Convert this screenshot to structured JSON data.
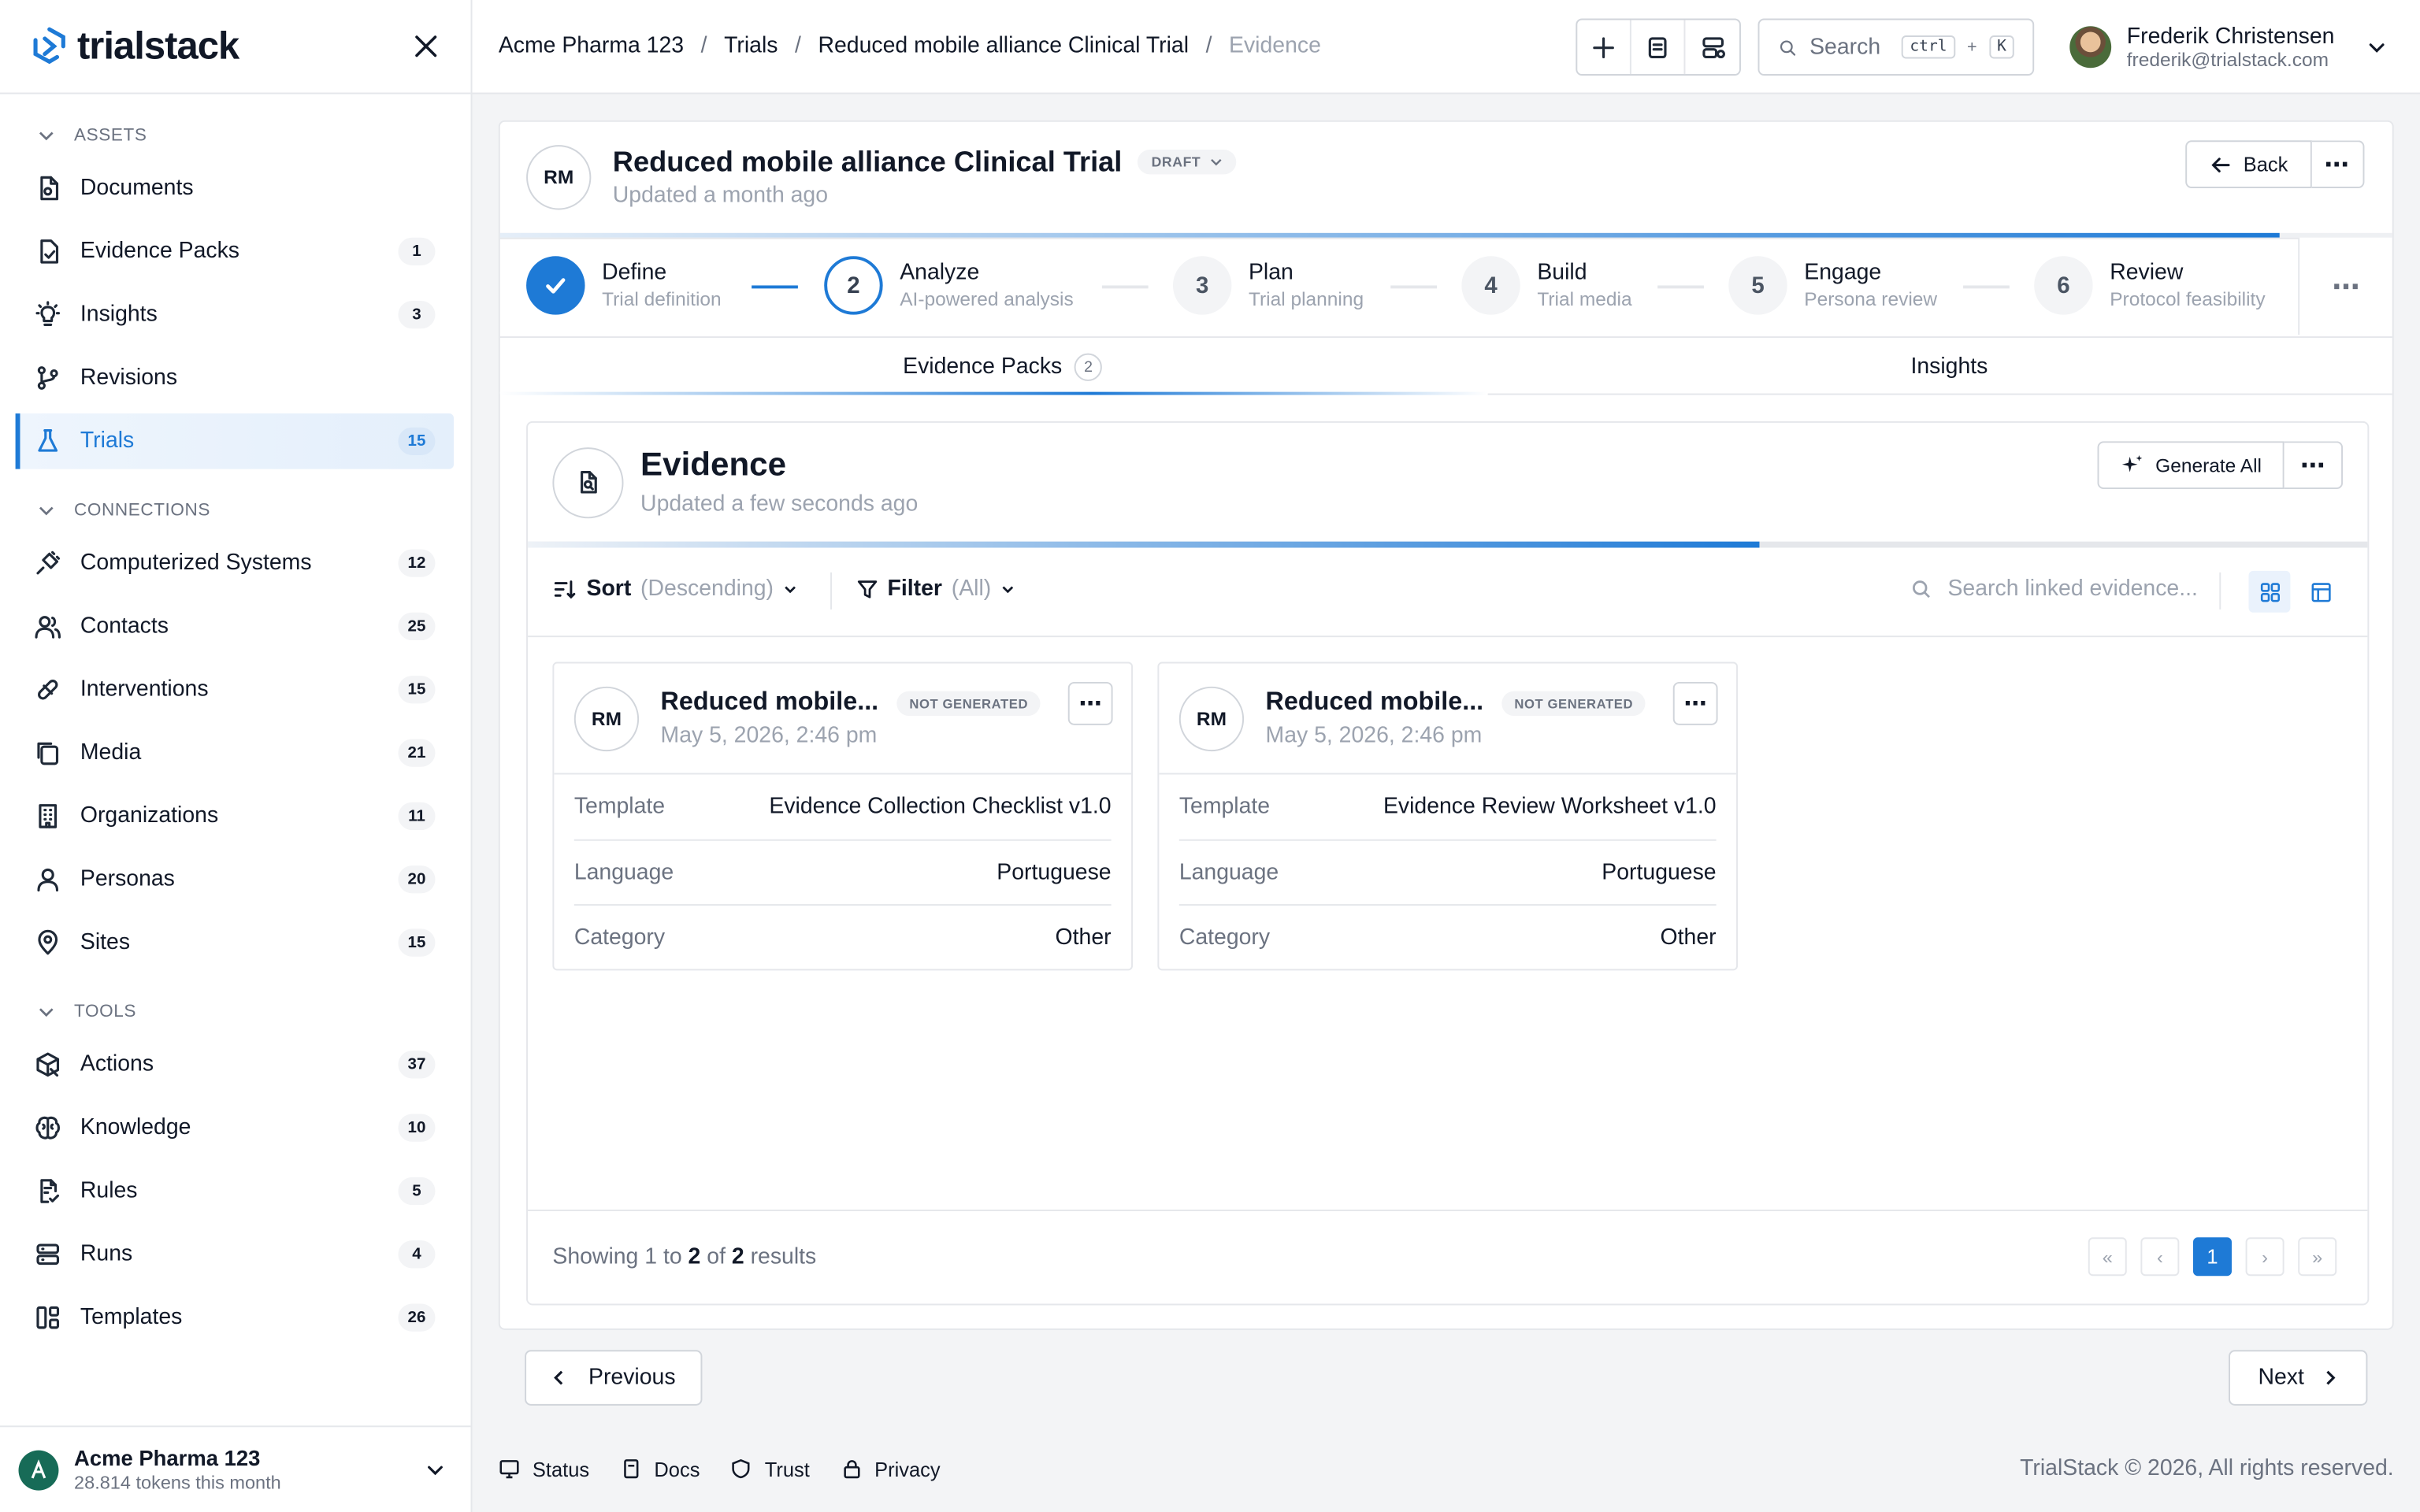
{
  "brand": {
    "name": "trialstack",
    "accent": "#1e7ad6"
  },
  "sidebar": {
    "sections": [
      {
        "label": "ASSETS",
        "items": [
          {
            "label": "Documents",
            "icon": "document-icon",
            "badge": ""
          },
          {
            "label": "Evidence Packs",
            "icon": "evidence-icon",
            "badge": "1"
          },
          {
            "label": "Insights",
            "icon": "lightbulb-icon",
            "badge": "3"
          },
          {
            "label": "Revisions",
            "icon": "git-branch-icon",
            "badge": ""
          },
          {
            "label": "Trials",
            "icon": "flask-icon",
            "badge": "15",
            "active": true
          }
        ]
      },
      {
        "label": "CONNECTIONS",
        "items": [
          {
            "label": "Computerized Systems",
            "icon": "plug-icon",
            "badge": "12"
          },
          {
            "label": "Contacts",
            "icon": "users-icon",
            "badge": "25"
          },
          {
            "label": "Interventions",
            "icon": "pill-icon",
            "badge": "15"
          },
          {
            "label": "Media",
            "icon": "copy-icon",
            "badge": "21"
          },
          {
            "label": "Organizations",
            "icon": "building-icon",
            "badge": "11"
          },
          {
            "label": "Personas",
            "icon": "person-icon",
            "badge": "20"
          },
          {
            "label": "Sites",
            "icon": "map-pin-icon",
            "badge": "15"
          }
        ]
      },
      {
        "label": "TOOLS",
        "items": [
          {
            "label": "Actions",
            "icon": "box-icon",
            "badge": "37"
          },
          {
            "label": "Knowledge",
            "icon": "brain-icon",
            "badge": "10"
          },
          {
            "label": "Rules",
            "icon": "file-check-icon",
            "badge": "5"
          },
          {
            "label": "Runs",
            "icon": "server-icon",
            "badge": "4"
          },
          {
            "label": "Templates",
            "icon": "layout-icon",
            "badge": "26"
          }
        ]
      }
    ],
    "org": {
      "name": "Acme Pharma 123",
      "tokens": "28.814 tokens this month"
    }
  },
  "topbar": {
    "breadcrumbs": [
      "Acme Pharma 123",
      "Trials",
      "Reduced mobile alliance Clinical Trial",
      "Evidence"
    ],
    "search": {
      "placeholder": "Search",
      "kbd1": "ctrl",
      "plus": "+",
      "kbd2": "K"
    },
    "user": {
      "name": "Frederik Christensen",
      "email": "frederik@trialstack.com"
    }
  },
  "trial": {
    "initials": "RM",
    "title": "Reduced mobile alliance Clinical Trial",
    "status": "DRAFT",
    "updated": "Updated a month ago",
    "back_label": "Back"
  },
  "steps": [
    {
      "num": "1",
      "title": "Define",
      "sub": "Trial definition",
      "state": "done"
    },
    {
      "num": "2",
      "title": "Analyze",
      "sub": "AI-powered analysis",
      "state": "current"
    },
    {
      "num": "3",
      "title": "Plan",
      "sub": "Trial planning",
      "state": "todo"
    },
    {
      "num": "4",
      "title": "Build",
      "sub": "Trial media",
      "state": "todo"
    },
    {
      "num": "5",
      "title": "Engage",
      "sub": "Persona review",
      "state": "todo"
    },
    {
      "num": "6",
      "title": "Review",
      "sub": "Protocol feasibility",
      "state": "todo"
    }
  ],
  "tabs": [
    {
      "label": "Evidence Packs",
      "count": "2",
      "active": true
    },
    {
      "label": "Insights",
      "count": "",
      "active": false
    }
  ],
  "evidence": {
    "title": "Evidence",
    "updated": "Updated a few seconds ago",
    "generate_all": "Generate All",
    "sort_label": "Sort",
    "sort_value": "(Descending)",
    "filter_label": "Filter",
    "filter_value": "(All)",
    "search_placeholder": "Search linked evidence...",
    "cards": [
      {
        "initials": "RM",
        "title": "Reduced mobile...",
        "status": "NOT GENERATED",
        "date": "May 5, 2026, 2:46 pm",
        "rows": [
          {
            "k": "Template",
            "v": "Evidence Collection Checklist v1.0"
          },
          {
            "k": "Language",
            "v": "Portuguese"
          },
          {
            "k": "Category",
            "v": "Other"
          }
        ]
      },
      {
        "initials": "RM",
        "title": "Reduced mobile...",
        "status": "NOT GENERATED",
        "date": "May 5, 2026, 2:46 pm",
        "rows": [
          {
            "k": "Template",
            "v": "Evidence Review Worksheet v1.0"
          },
          {
            "k": "Language",
            "v": "Portuguese"
          },
          {
            "k": "Category",
            "v": "Other"
          }
        ]
      }
    ],
    "pagination": {
      "prefix": "Showing 1 to ",
      "to": "2",
      "mid": " of ",
      "total": "2",
      "suffix": " results",
      "current_page": "1"
    }
  },
  "nav": {
    "previous": "Previous",
    "next": "Next"
  },
  "footer": {
    "links": [
      "Status",
      "Docs",
      "Trust",
      "Privacy"
    ],
    "copyright": "TrialStack © 2026, All rights reserved."
  }
}
